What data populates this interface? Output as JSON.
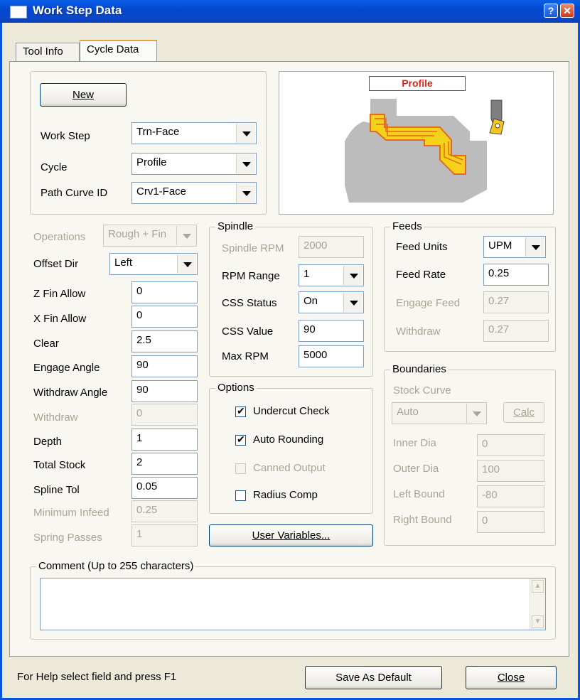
{
  "window": {
    "title": "Work Step Data"
  },
  "tabs": [
    {
      "label": "Tool Info"
    },
    {
      "label": "Cycle Data"
    }
  ],
  "header": {
    "new_button": "New",
    "work_step_label": "Work Step",
    "work_step_value": "Trn-Face",
    "cycle_label": "Cycle",
    "cycle_value": "Profile",
    "path_curve_label": "Path Curve ID",
    "path_curve_value": "Crv1-Face"
  },
  "preview": {
    "title": "Profile"
  },
  "left": {
    "operations_label": "Operations",
    "operations_value": "Rough + Fin",
    "offset_dir_label": "Offset Dir",
    "offset_dir_value": "Left",
    "z_fin_label": "Z Fin Allow",
    "z_fin_value": "0",
    "x_fin_label": "X Fin Allow",
    "x_fin_value": "0",
    "clear_label": "Clear",
    "clear_value": "2.5",
    "engage_angle_label": "Engage Angle",
    "engage_angle_value": "90",
    "withdraw_angle_label": "Withdraw Angle",
    "withdraw_angle_value": "90",
    "withdraw_label": "Withdraw",
    "withdraw_value": "0",
    "depth_label": "Depth",
    "depth_value": "1",
    "total_stock_label": "Total Stock",
    "total_stock_value": "2",
    "spline_tol_label": "Spline Tol",
    "spline_tol_value": "0.05",
    "min_infeed_label": "Minimum Infeed",
    "min_infeed_value": "0.25",
    "spring_passes_label": "Spring Passes",
    "spring_passes_value": "1"
  },
  "spindle": {
    "legend": "Spindle",
    "rpm_label": "Spindle RPM",
    "rpm_value": "2000",
    "range_label": "RPM Range",
    "range_value": "1",
    "css_status_label": "CSS Status",
    "css_status_value": "On",
    "css_value_label": "CSS Value",
    "css_value_value": "90",
    "max_rpm_label": "Max RPM",
    "max_rpm_value": "5000"
  },
  "feeds": {
    "legend": "Feeds",
    "units_label": "Feed Units",
    "units_value": "UPM",
    "rate_label": "Feed Rate",
    "rate_value": "0.25",
    "engage_label": "Engage Feed",
    "engage_value": "0.27",
    "withdraw_label": "Withdraw",
    "withdraw_value": "0.27"
  },
  "options": {
    "legend": "Options",
    "undercut": {
      "label": "Undercut Check",
      "checked": true
    },
    "auto_rounding": {
      "label": "Auto Rounding",
      "checked": true
    },
    "canned_output": {
      "label": "Canned Output",
      "checked": false
    },
    "radius_comp": {
      "label": "Radius Comp",
      "checked": false
    }
  },
  "user_variables_button": "User Variables...",
  "boundaries": {
    "legend": "Boundaries",
    "stock_curve_label": "Stock Curve",
    "stock_curve_value": "Auto",
    "calc_button": "Calc",
    "inner_dia_label": "Inner Dia",
    "inner_dia_value": "0",
    "outer_dia_label": "Outer Dia",
    "outer_dia_value": "100",
    "left_bound_label": "Left Bound",
    "left_bound_value": "-80",
    "right_bound_label": "Right Bound",
    "right_bound_value": "0"
  },
  "comment": {
    "legend": "Comment  (Up to 255 characters)",
    "value": ""
  },
  "footer": {
    "help_text": "For Help select field and press F1",
    "save_default_button": "Save As Default",
    "close_button": "Close"
  },
  "colors": {
    "title_bar": "#0a54e0",
    "preview_title": "#e0201b",
    "toolpath": "#f5d21a"
  }
}
